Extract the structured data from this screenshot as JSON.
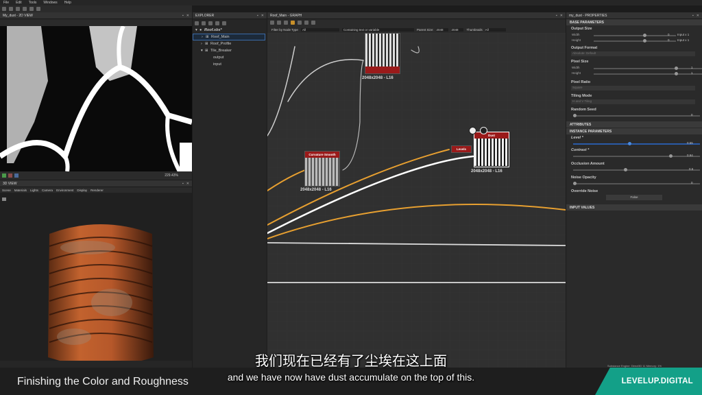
{
  "menu": [
    "File",
    "Edit",
    "Tools",
    "Windows",
    "Help"
  ],
  "view2d": {
    "title": "My_dust - 2D VIEW",
    "zoom": "229.43%"
  },
  "view3d": {
    "title": "3D VIEW",
    "menu": [
      "Scene",
      "Materials",
      "Lights",
      "Camera",
      "Environment",
      "Display",
      "Renderer"
    ]
  },
  "explorer": {
    "title": "EXPLORER",
    "items": [
      {
        "label": "Roof.sbs*"
      },
      {
        "label": "Roof_Main"
      },
      {
        "label": "Roof_Profile"
      },
      {
        "label": "Tile_Breaker"
      },
      {
        "label": "output"
      },
      {
        "label": "input"
      }
    ]
  },
  "graph": {
    "title": "Roof_Main - GRAPH",
    "filter_label": "Filter by Node Type",
    "filter_value": "All",
    "contains_label": "Containing text or variable",
    "parent_size_label": "Parent Size:",
    "parent_size": "2048",
    "size2": "2048",
    "thumbnails_label": "Thumbnails",
    "thumbnails_value": "All",
    "nodes": {
      "top_res": "2048x2048 - L16",
      "curv_title": "Curvature Smooth",
      "curv_res": "2048x2048 - L16",
      "dust_title": "Dust",
      "dust_res": "2048x2048 - L16",
      "levels_title": "Levels"
    }
  },
  "properties": {
    "title": "my_dust - PROPERTIES",
    "base_section": "BASE PARAMETERS",
    "output_size": "Output Size",
    "width_label": "Width",
    "height_label": "Height",
    "width_val": "0",
    "height_val": "0",
    "relative": "Relative to pa...",
    "input1": "Input x 1",
    "input2": "Input x 1",
    "output_format": "Output Format",
    "output_format_val": "Absolute: Default",
    "pixel_size": "Pixel Size",
    "pw": "1",
    "ph": "1",
    "pixel_ratio": "Pixel Ratio",
    "pixel_ratio_val": "Square",
    "tiling_mode": "Tiling Mode",
    "tiling_val": "H and V Tiling",
    "random_seed": "Random Seed",
    "seed_val": "0",
    "attributes": "ATTRIBUTES",
    "instance_section": "INSTANCE PARAMETERS",
    "level": "Level *",
    "level_val": "0.55",
    "contrast": "Contrast *",
    "contrast_val": "0.94",
    "occlusion": "Occlusion Amount",
    "occlusion_val": "0.5",
    "noise_opacity": "Noise Opacity",
    "noise_val": "0",
    "override_noise": "Override Noise",
    "override_val": "False",
    "input_values": "INPUT VALUES"
  },
  "status": "Substance Engine: Direct3D 11  Memory: 1%",
  "caption_cn": "我们现在已经有了尘埃在这上面",
  "caption_en": "and we have now have dust accumulate on the top of this.",
  "course_title": "Finishing the Color and Roughness",
  "brand": "LEVELUP.DIGITAL",
  "colors": {
    "accent": "#13a088",
    "node_red": "#9a1a1a",
    "wire_orange": "#e8a030"
  }
}
